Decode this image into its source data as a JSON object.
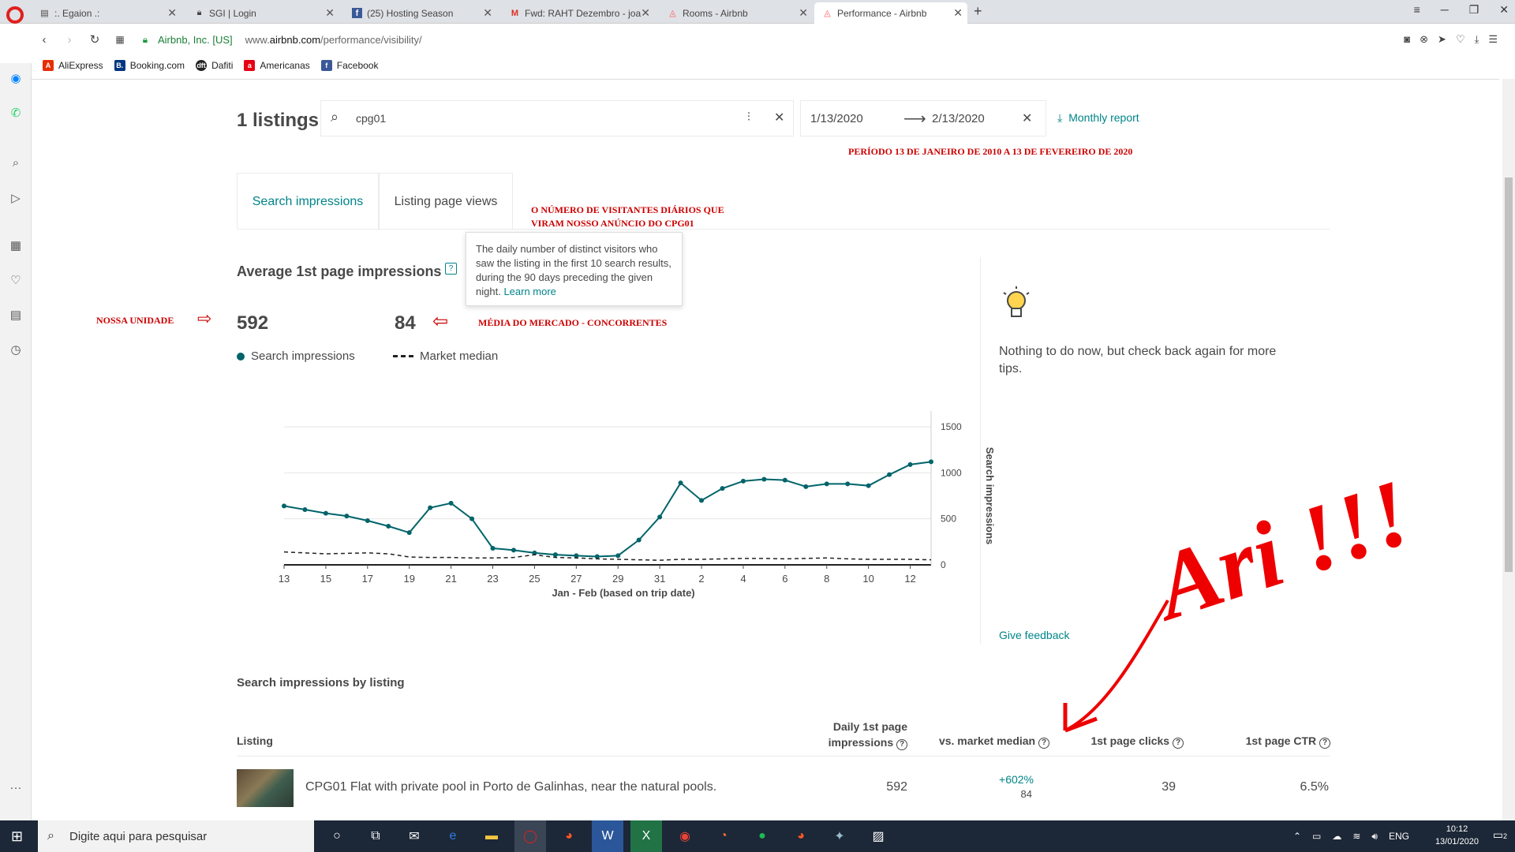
{
  "browser": {
    "tabs": [
      {
        "title": ":. Egaion .:",
        "icon": "document-icon"
      },
      {
        "title": "SGI | Login",
        "icon": "lock-icon"
      },
      {
        "title": "(25) Hosting Season",
        "icon": "facebook-icon"
      },
      {
        "title": "Fwd: RAHT Dezembro - joa",
        "icon": "gmail-icon"
      },
      {
        "title": "Rooms - Airbnb",
        "icon": "airbnb-icon"
      },
      {
        "title": "Performance - Airbnb",
        "icon": "airbnb-icon"
      }
    ],
    "secure_label": "Airbnb, Inc. [US]",
    "url_prefix": "www.",
    "url_domain": "airbnb.com",
    "url_path": "/performance/visibility/",
    "bookmarks": [
      {
        "label": "AliExpress",
        "color": "#e62e04"
      },
      {
        "label": "Booking.com",
        "color": "#003580"
      },
      {
        "label": "Dafiti",
        "color": "#222222"
      },
      {
        "label": "Americanas",
        "color": "#e60014"
      },
      {
        "label": "Facebook",
        "color": "#3b5998"
      }
    ]
  },
  "header": {
    "listings_count": "1 listings",
    "search_value": "cpg01",
    "date_start": "1/13/2020",
    "date_end": "2/13/2020",
    "monthly_report": "Monthly report"
  },
  "tabs": {
    "search_impressions": "Search impressions",
    "listing_page_views": "Listing page views"
  },
  "section": {
    "title": "Average 1st page impressions",
    "tooltip_text": "The daily number of distinct visitors who saw the listing in the first 10 search results, during the 90 days preceding the given night.",
    "tooltip_link": "Learn more",
    "value_listing": "592",
    "value_market": "84",
    "legend_search": "Search impressions",
    "legend_market": "Market median"
  },
  "annotations": {
    "periodo": "PERÍODO  13 DE JANEIRO DE 2010 A 13 DE FEVEREIRO DE 2020",
    "visitantes_line1": "O NÚMERO DE VISITANTES DIÁRIOS QUE",
    "visitantes_line2": "VIRAM NOSSO ANÚNCIO DO CPG01",
    "nossa_unidade": "NOSSA UNIDADE",
    "media_mercado": "MÉDIA DO MERCADO - CONCORRENTES",
    "handwriting": "Ari !!!"
  },
  "chart_data": {
    "type": "line",
    "xlabel": "Jan - Feb (based on trip date)",
    "ylabel": "Search impressions",
    "ylim": [
      0,
      1500
    ],
    "yticks": [
      0,
      500,
      1000,
      1500
    ],
    "xtick_labels": [
      "13",
      "15",
      "17",
      "19",
      "21",
      "23",
      "25",
      "27",
      "29",
      "31",
      "2",
      "4",
      "6",
      "8",
      "10",
      "12"
    ],
    "x": [
      "Jan 13",
      "Jan 14",
      "Jan 15",
      "Jan 16",
      "Jan 17",
      "Jan 18",
      "Jan 19",
      "Jan 20",
      "Jan 21",
      "Jan 22",
      "Jan 23",
      "Jan 24",
      "Jan 25",
      "Jan 26",
      "Jan 27",
      "Jan 28",
      "Jan 29",
      "Jan 30",
      "Jan 31",
      "Feb 1",
      "Feb 2",
      "Feb 3",
      "Feb 4",
      "Feb 5",
      "Feb 6",
      "Feb 7",
      "Feb 8",
      "Feb 9",
      "Feb 10",
      "Feb 11",
      "Feb 12",
      "Feb 13"
    ],
    "series": [
      {
        "name": "Search impressions",
        "color": "#00646a",
        "style": "solid",
        "values": [
          640,
          600,
          560,
          530,
          480,
          420,
          350,
          620,
          670,
          500,
          180,
          160,
          130,
          110,
          100,
          90,
          100,
          270,
          520,
          890,
          700,
          830,
          910,
          930,
          920,
          850,
          880,
          880,
          860,
          980,
          1090,
          1120
        ]
      },
      {
        "name": "Market median",
        "color": "#222222",
        "style": "dashed",
        "values": [
          140,
          130,
          120,
          125,
          130,
          120,
          85,
          80,
          80,
          75,
          75,
          80,
          110,
          80,
          75,
          65,
          60,
          55,
          50,
          60,
          60,
          65,
          70,
          70,
          65,
          70,
          75,
          65,
          60,
          60,
          60,
          55
        ]
      }
    ]
  },
  "tips": {
    "text": "Nothing to do now, but check back again for more tips.",
    "feedback": "Give feedback"
  },
  "table": {
    "title": "Search impressions by listing",
    "headers": {
      "listing": "Listing",
      "daily_line1": "Daily 1st page",
      "daily_line2": "impressions",
      "vs_market": "vs. market median",
      "clicks": "1st page clicks",
      "ctr": "1st page CTR"
    },
    "rows": [
      {
        "name": "CPG01 Flat with private pool in Porto de Galinhas, near the natural pools.",
        "impressions": "592",
        "vs_pct": "+602%",
        "vs_val": "84",
        "clicks": "39",
        "ctr": "6.5%"
      }
    ]
  },
  "taskbar": {
    "search_placeholder": "Digite aqui para pesquisar",
    "lang": "ENG",
    "time": "10:12",
    "date": "13/01/2020",
    "notifications": "2"
  }
}
